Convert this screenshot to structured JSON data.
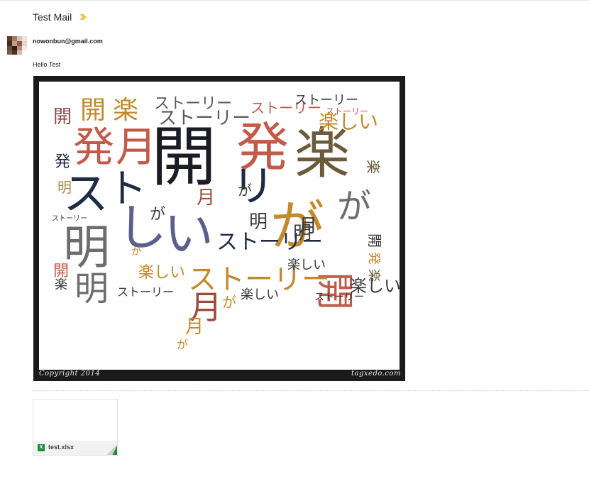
{
  "email": {
    "subject": "Test Mail",
    "sender": "nowonbun@gmail.com",
    "body": "Hello Test"
  },
  "image": {
    "copyright_left": "Copyright 2014",
    "copyright_right": "tagxedo.com"
  },
  "word_cloud": {
    "words": [
      "開",
      "発",
      "楽",
      "し",
      "い",
      "ス",
      "ト",
      "ー",
      "リ",
      "月",
      "明",
      "が",
      "開発",
      "楽しい",
      "ストーリー"
    ]
  },
  "attachment": {
    "filename": "test.xlsx",
    "file_type": "X"
  }
}
